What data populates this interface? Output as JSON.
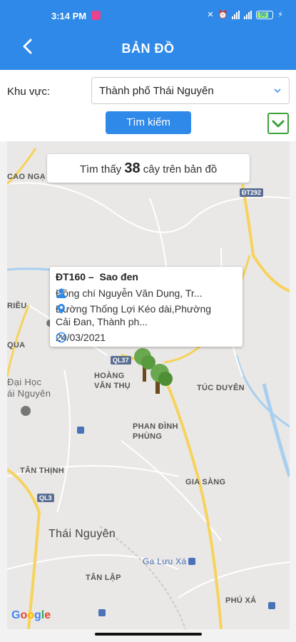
{
  "status": {
    "time": "3:14 PM",
    "battery": "56"
  },
  "header": {
    "title": "BẢN ĐỒ"
  },
  "filter": {
    "area_label": "Khu vực:",
    "area_value": "Thành phố Thái Nguyên",
    "search_label": "Tìm kiếm"
  },
  "result": {
    "prefix": "Tìm thấy",
    "count": "38",
    "suffix": "cây trên bản đồ"
  },
  "popup": {
    "code": "ĐT160 –",
    "species": "Sao đen",
    "person": "Đồng chí Nguyễn Văn Dụng, Tr...",
    "address": "Đường Thống Lợi Kéo dài,Phường Cải Đan, Thành ph...",
    "date": "24/03/2021"
  },
  "map": {
    "places": {
      "cao_ngan": "CAO NGẠ",
      "tan_thinh": "TÂN THỊNH",
      "hoang_van_thu": "HOÀNG\nVĂN THỤ",
      "tuc_duyen": "TÚC DUYÊN",
      "phan_dinh_phung": "PHAN ĐÌNH\nPHÙNG",
      "gia_sang": "GIA SÀNG",
      "thai_nguyen": "Thái Nguyên",
      "ga_luu_xa": "Ga Lưu Xá",
      "tan_lap": "TÂN LẬP",
      "phu_xa": "PHÚ XÁ",
      "dai_hoc": "Đại Học\nái Nguyên",
      "rieu": "RIỀU",
      "quan": "QUA"
    },
    "roads": {
      "dt292": "ĐT292",
      "ql37": "QL37",
      "ql3": "QL3"
    },
    "attribution": "Google"
  },
  "icons": {
    "back": "chevron-left-icon",
    "dropdown": "chevron-down-icon",
    "toggle": "chevron-down-icon",
    "person": "person-icon",
    "location": "location-pin-icon",
    "clock": "clock-icon",
    "tree": "tree-marker-icon"
  },
  "colors": {
    "primary": "#2f89e8",
    "toggle_border": "#3aa23a",
    "road_major": "#f7d25c",
    "water": "#a9cff0"
  }
}
